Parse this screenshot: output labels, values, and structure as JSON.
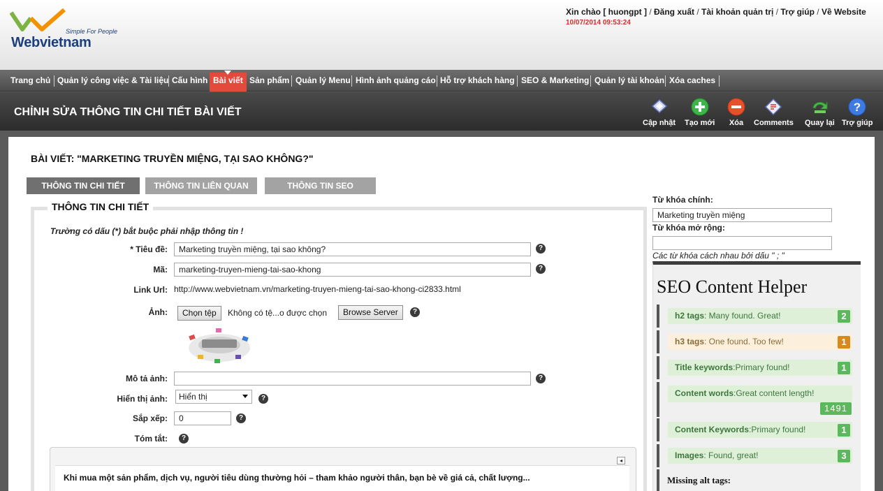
{
  "brand": {
    "name": "Webvietnam",
    "tagline": "Simple For People",
    "colors": {
      "blue": "#1c3f7c",
      "green": "#7cb342",
      "orange": "#f39200"
    }
  },
  "user_links": {
    "greeting": "Xin chào [ huongpt ]",
    "logout": "Đăng xuất",
    "admin_account": "Tài khoản quản trị",
    "help": "Trợ giúp",
    "website": "Về Website",
    "sep": " / ",
    "datetime": "10/07/2014 09:53:24"
  },
  "menu": [
    {
      "label": "Trang chủ",
      "active": false
    },
    {
      "label": "Quản lý công việc & Tài liệu",
      "active": false
    },
    {
      "label": "Cấu hình",
      "active": false
    },
    {
      "label": "Bài viết",
      "active": true
    },
    {
      "label": "Sản phẩm",
      "active": false
    },
    {
      "label": "Quản lý Menu",
      "active": false
    },
    {
      "label": "Hình ảnh quảng cáo",
      "active": false
    },
    {
      "label": "Hỗ trợ khách hàng",
      "active": false
    },
    {
      "label": "SEO & Marketing",
      "active": false
    },
    {
      "label": "Quản lý tài khoản",
      "active": false
    },
    {
      "label": "Xóa caches",
      "active": false
    }
  ],
  "page_title": "CHỈNH SỬA THÔNG TIN CHI TIẾT BÀI VIẾT",
  "toolbar": [
    {
      "label": "Cập nhật",
      "icon": "save-icon"
    },
    {
      "label": "Tạo mới",
      "icon": "add-icon"
    },
    {
      "label": "Xóa",
      "icon": "delete-icon"
    },
    {
      "label": "Comments",
      "icon": "comments-icon"
    },
    {
      "label": "Quay lại",
      "icon": "back-icon"
    },
    {
      "label": "Trợ giúp",
      "icon": "help-icon"
    }
  ],
  "post_heading": "BÀI VIẾT: \"MARKETING TRUYỀN MIỆNG, TẠI SAO KHÔNG?\"",
  "tabs": [
    {
      "label": "THÔNG TIN CHI TIẾT",
      "active": true
    },
    {
      "label": "THÔNG TIN LIÊN QUAN",
      "active": false
    },
    {
      "label": "THÔNG TIN SEO",
      "active": false
    }
  ],
  "form": {
    "legend": "THÔNG TIN CHI TIẾT",
    "required_note": "Trường có dấu (*) bắt buộc phải nhập thông tin !",
    "title_label": "* Tiêu đề:",
    "title_value": "Marketing truyền miệng, tại sao không?",
    "code_label": "Mã:",
    "code_value": "marketing-truyen-mieng-tai-sao-khong",
    "link_label": "Link Url:",
    "link_value": "http://www.webvietnam.vn/marketing-truyen-mieng-tai-sao-khong-ci2833.html",
    "image_label": "Ảnh:",
    "choose_file": "Chọn tệp",
    "no_file": "Không có tệ...o được chọn",
    "browse_server": "Browse Server",
    "image_alt_label": "Mô tả ảnh:",
    "image_alt_value": "",
    "show_image_label": "Hiển thị ảnh:",
    "show_image_value": "Hiển thị",
    "order_label": "Sắp xếp:",
    "order_value": "0",
    "summary_label": "Tóm tắt:",
    "summary_text": "Khi mua một sản phẩm, dịch vụ, người tiêu dùng thường hỏi – tham khảo người thân, bạn bè về giá cả, chất lượng...",
    "help_glyph": "?"
  },
  "keywords": {
    "main_label": "Từ khóa chính:",
    "main_value": "Marketing truyền miệng",
    "ext_label": "Từ khóa mở rộng:",
    "ext_value": "",
    "note": "Các từ khóa cách nhau bởi dấu \" ; \""
  },
  "seo_helper": {
    "title": "SEO Content Helper",
    "items": [
      {
        "key": "h2 tags",
        "text": ": Many found. Great!",
        "count": "2",
        "status": "ok"
      },
      {
        "key": "h3 tags",
        "text": ": One found. Too few!",
        "count": "1",
        "status": "warn"
      },
      {
        "key": "Title keywords",
        "text": ":Primary found!",
        "count": "1",
        "status": "ok"
      },
      {
        "key": "Content words",
        "text": ":Great content length!",
        "count": "1491",
        "status": "ok"
      },
      {
        "key": "Content Keywords",
        "text": ":Primary found!",
        "count": "1",
        "status": "ok"
      },
      {
        "key": "Images",
        "text": ": Found, great!",
        "count": "3",
        "status": "ok"
      }
    ],
    "missing_alt": "Missing alt tags:"
  }
}
